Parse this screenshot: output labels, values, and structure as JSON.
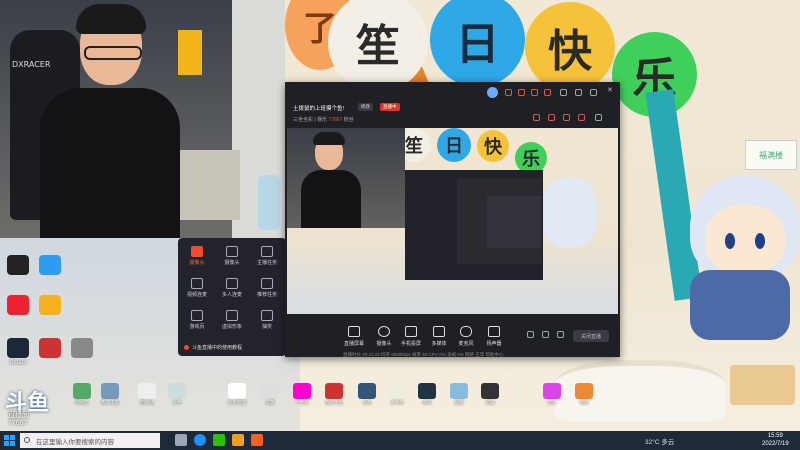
{
  "background": {
    "balloon_chars": [
      "了",
      "笙",
      "日",
      "快",
      "乐"
    ],
    "sign_text": "福满楼"
  },
  "webcam": {
    "chair_brand": "DXRACER"
  },
  "desktop_left_icons": [
    {
      "label": "",
      "color": "#222"
    },
    {
      "label": "",
      "color": "#2e9cf0"
    },
    {
      "label": "",
      "color": "#555"
    },
    {
      "label": "",
      "color": "#e23"
    },
    {
      "label": "",
      "color": "#f5b21e"
    },
    {
      "label": "",
      "color": "#444"
    },
    {
      "label": "Steam",
      "color": "#1b2838"
    },
    {
      "label": "",
      "color": "#c33"
    },
    {
      "label": "",
      "color": "#888"
    }
  ],
  "quick_panel": {
    "items": [
      {
        "label": "摄像头",
        "accent": true
      },
      {
        "label": "摄像头",
        "accent": false
      },
      {
        "label": "主播任务",
        "accent": false
      },
      {
        "label": "视频连麦",
        "accent": false
      },
      {
        "label": "多人连麦",
        "accent": false
      },
      {
        "label": "推荐任务",
        "accent": false
      },
      {
        "label": "游戏页",
        "accent": false
      },
      {
        "label": "虚拟形象",
        "accent": false
      },
      {
        "label": "抽奖",
        "accent": false
      }
    ],
    "notice": "斗鱼直播中的使用教程"
  },
  "app": {
    "title": "土拨鼠的上班摸个鱼!",
    "edit_label": "修改",
    "badge_label": "直播中",
    "meta_prefix": "三坐全彩 | 娱乐",
    "meta_viewers": "77667",
    "meta_suffix": "粉丝",
    "preview_balloons": [
      "了",
      "笙",
      "日",
      "快",
      "乐"
    ],
    "toolbar": [
      {
        "label": "直播屏幕"
      },
      {
        "label": "摄像头"
      },
      {
        "label": "手机投屏"
      },
      {
        "label": "多媒体"
      },
      {
        "label": "麦克风"
      },
      {
        "label": "扬声器"
      }
    ],
    "start_label": "关闭直播",
    "status_text": "直播时长 00:41:22   码率 6000kbps   帧率 60   CPU 0%   丢帧 0%   网络 正常   帮助中心"
  },
  "desktop_bottom_icons": [
    {
      "label": "网易云",
      "color": "#5a6"
    },
    {
      "label": "我的电脑",
      "color": "#79b"
    },
    {
      "label": "回收站",
      "color": "#eee"
    },
    {
      "label": "文件",
      "color": "#cdd"
    },
    {
      "label": "任务管理",
      "color": "#fff"
    },
    {
      "label": "设置",
      "color": "#ddd"
    },
    {
      "label": "个性化",
      "color": "#f0c"
    },
    {
      "label": "直播伴侣",
      "color": "#c33"
    },
    {
      "label": "设备",
      "color": "#357"
    },
    {
      "label": "文件夹",
      "color": "#eed"
    },
    {
      "label": "游戏",
      "color": "#234"
    },
    {
      "label": "截图",
      "color": "#8bd"
    },
    {
      "label": "剪辑",
      "color": "#333"
    },
    {
      "label": "音乐",
      "color": "#d4e"
    },
    {
      "label": "视频",
      "color": "#e83"
    }
  ],
  "watermark": {
    "logo": "斗鱼",
    "sub": "直播间",
    "number": "77667"
  },
  "taskbar": {
    "search_placeholder": "在这里输入你要搜索的内容",
    "weather": "32°C 多云",
    "time": "15:59",
    "date": "2022/7/19",
    "apps": [
      {
        "name": "task-view",
        "color": "#9aa7b8"
      },
      {
        "name": "edge",
        "color": "#1e90ff"
      },
      {
        "name": "wechat",
        "color": "#2dc100"
      },
      {
        "name": "browser",
        "color": "#f0a020"
      },
      {
        "name": "douyu",
        "color": "#f26322"
      }
    ]
  }
}
